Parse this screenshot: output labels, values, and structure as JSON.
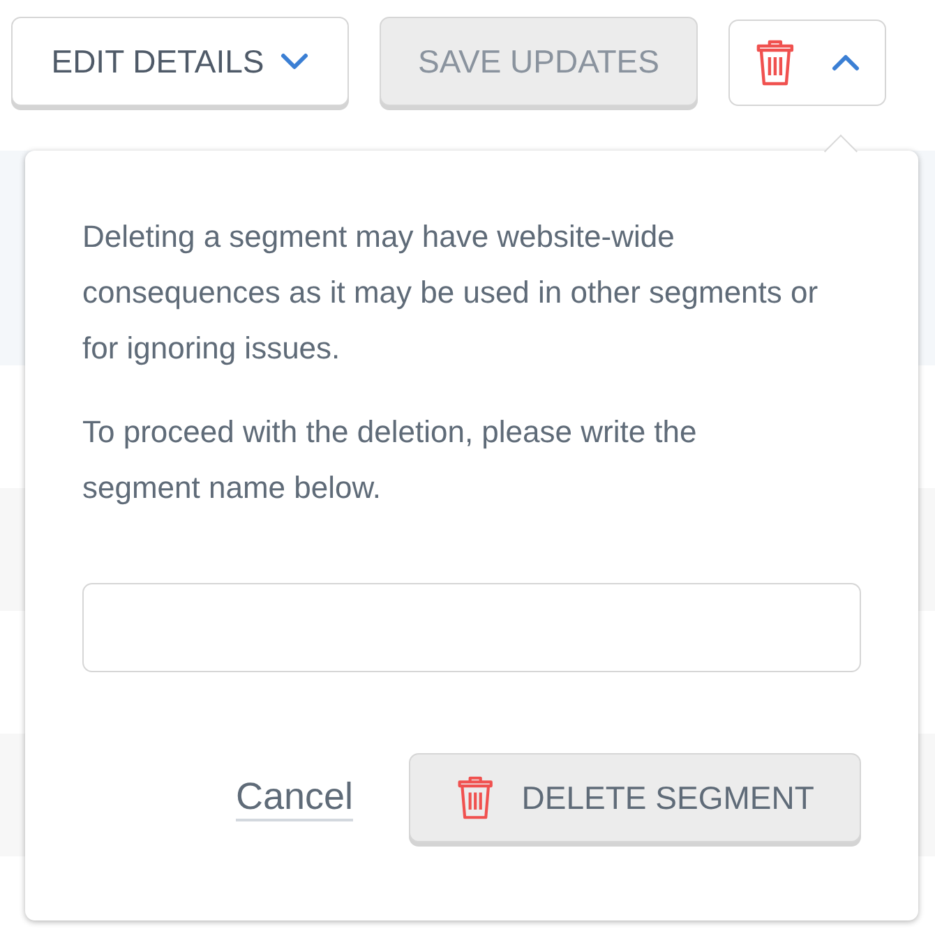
{
  "toolbar": {
    "edit_button": {
      "label": "EDIT DETAILS",
      "expanded": false
    },
    "save_button": {
      "label": "SAVE UPDATES",
      "disabled": true
    },
    "delete_toggle": {
      "expanded": true
    }
  },
  "delete_popover": {
    "paragraphs": [
      "Deleting a segment may have website-wide consequences as it may be used in other segments or for ignoring issues.",
      "To proceed with the deletion, please write the segment name below."
    ],
    "cancel_link": "Cancel",
    "delete_button": {
      "label": "DELETE SEGMENT",
      "disabled": false
    }
  }
}
